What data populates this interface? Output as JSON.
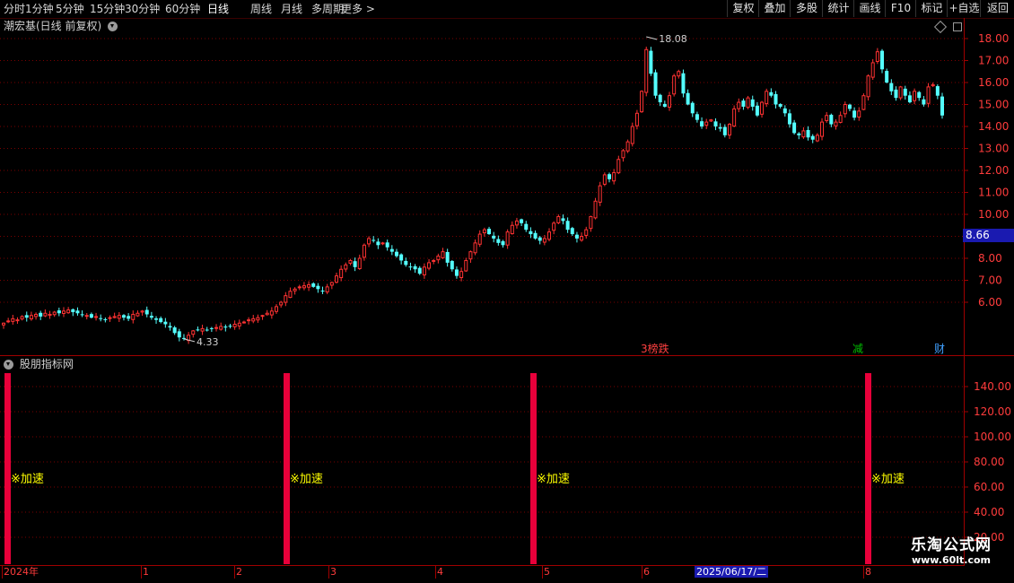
{
  "toolbar": {
    "periods": [
      "分时",
      "1分钟",
      "5分钟",
      "15分钟",
      "30分钟",
      "60分钟",
      "日线",
      "周线",
      "月线",
      "多周期",
      "更多 >"
    ],
    "active_period": "日线",
    "right_buttons": [
      "复权",
      "叠加",
      "多股",
      "统计",
      "画线",
      "F10",
      "标记",
      "+自选",
      "返回"
    ]
  },
  "main_chart": {
    "title": "潮宏基(日线 前复权)",
    "price_ticks": [
      "18.00",
      "17.00",
      "16.00",
      "15.00",
      "14.00",
      "13.00",
      "12.00",
      "11.00",
      "10.00",
      "9.00",
      "8.00",
      "7.00",
      "6.00"
    ],
    "current_price": "8.66",
    "high_label": "18.08",
    "low_label": "4.33",
    "event_markers": [
      {
        "label": "3榜跌",
        "color": "#ff4040"
      },
      {
        "label": "减",
        "color": "#00c000"
      },
      {
        "label": "财",
        "color": "#40a0ff"
      }
    ]
  },
  "indicator": {
    "title": "股朋指标网",
    "ticks": [
      "140.00",
      "120.00",
      "100.00",
      "80.00",
      "60.00",
      "40.00",
      "20.00"
    ],
    "signal_label": "※加速"
  },
  "x_axis": {
    "labels": [
      "2024年",
      "1",
      "2",
      "3",
      "4",
      "5",
      "6",
      "8"
    ],
    "date_tag": "2025/06/17/二"
  },
  "watermark": {
    "name": "乐淘公式网",
    "url": "www.60lt.com"
  },
  "colors": {
    "up": "#ff3232",
    "down": "#54ffff",
    "grid": "#7a0000",
    "axis_text": "#ff3c3c",
    "signal_bar": "#e8003a",
    "signal_text": "#ffff00"
  },
  "chart_data": {
    "type": "candlestick",
    "ylim": [
      4.0,
      18.5
    ],
    "closes": [
      5.05,
      5.15,
      5.25,
      5.2,
      5.35,
      5.3,
      5.4,
      5.45,
      5.35,
      5.5,
      5.45,
      5.55,
      5.5,
      5.6,
      5.65,
      5.55,
      5.5,
      5.45,
      5.4,
      5.3,
      5.35,
      5.25,
      5.2,
      5.3,
      5.35,
      5.4,
      5.3,
      5.25,
      5.45,
      5.5,
      5.6,
      5.45,
      5.3,
      5.2,
      5.1,
      5.0,
      4.85,
      4.6,
      4.4,
      4.33,
      4.5,
      4.7,
      4.75,
      4.8,
      4.75,
      4.8,
      4.85,
      4.9,
      4.85,
      4.9,
      5.0,
      5.05,
      5.1,
      5.2,
      5.25,
      5.3,
      5.4,
      5.5,
      5.6,
      5.8,
      6.0,
      6.3,
      6.5,
      6.6,
      6.7,
      6.75,
      6.8,
      6.7,
      6.6,
      6.5,
      6.7,
      6.9,
      7.2,
      7.5,
      7.7,
      7.9,
      7.6,
      8.0,
      8.6,
      8.9,
      8.8,
      8.6,
      8.7,
      8.5,
      8.3,
      8.1,
      7.9,
      7.7,
      7.6,
      7.5,
      7.3,
      7.6,
      7.8,
      7.9,
      8.1,
      8.3,
      7.8,
      7.5,
      7.2,
      7.4,
      7.9,
      8.3,
      8.7,
      9.1,
      9.3,
      9.1,
      8.9,
      8.7,
      8.6,
      9.2,
      9.5,
      9.7,
      9.6,
      9.3,
      9.1,
      8.9,
      8.8,
      8.9,
      9.2,
      9.6,
      9.9,
      9.7,
      9.3,
      9.1,
      8.9,
      9.0,
      9.3,
      9.9,
      10.6,
      11.3,
      11.8,
      11.6,
      11.9,
      12.5,
      12.9,
      13.3,
      14.0,
      14.6,
      15.6,
      17.5,
      16.4,
      15.4,
      15.1,
      14.9,
      15.4,
      16.3,
      16.5,
      15.5,
      15.0,
      14.6,
      14.3,
      14.0,
      14.2,
      14.3,
      14.0,
      13.9,
      13.6,
      14.1,
      14.8,
      15.1,
      14.9,
      15.3,
      14.9,
      14.5,
      15.1,
      15.6,
      15.4,
      15.0,
      14.9,
      14.6,
      14.1,
      13.7,
      13.6,
      13.8,
      13.5,
      13.4,
      13.6,
      14.2,
      14.5,
      14.1,
      14.2,
      14.5,
      15.0,
      14.8,
      14.4,
      14.7,
      15.4,
      16.3,
      16.9,
      17.4,
      16.6,
      16.0,
      15.6,
      15.3,
      15.8,
      15.4,
      15.1,
      15.6,
      15.3,
      15.0,
      15.8,
      15.9,
      15.4,
      14.5
    ]
  }
}
